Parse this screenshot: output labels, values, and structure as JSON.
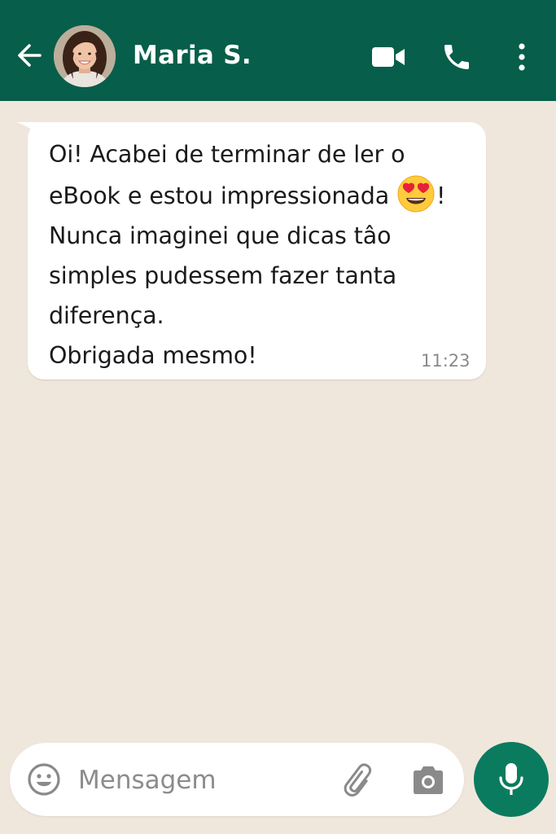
{
  "header": {
    "contact_name": "Maria S.",
    "background_color": "#075e4a"
  },
  "message": {
    "text_before_emoji": "Oi! Acabei de terminar de ler o eBook e estou impressionada",
    "emoji": "smiling-face-with-heart-eyes",
    "text_after_emoji": "! Nunca imaginei que dicas tâo simples pudessem fazer tanta diferença.",
    "text_last_line": "Obrigada mesmo!",
    "time": "11:23"
  },
  "composer": {
    "placeholder": "Mensagem",
    "value": "",
    "send_button_color": "#0b7b5f"
  },
  "chat_background": "#f0e7dc",
  "icons": [
    "back-arrow-icon",
    "video-camera-icon",
    "phone-icon",
    "more-vertical-icon",
    "emoji-icon",
    "paperclip-icon",
    "camera-icon",
    "microphone-icon"
  ]
}
